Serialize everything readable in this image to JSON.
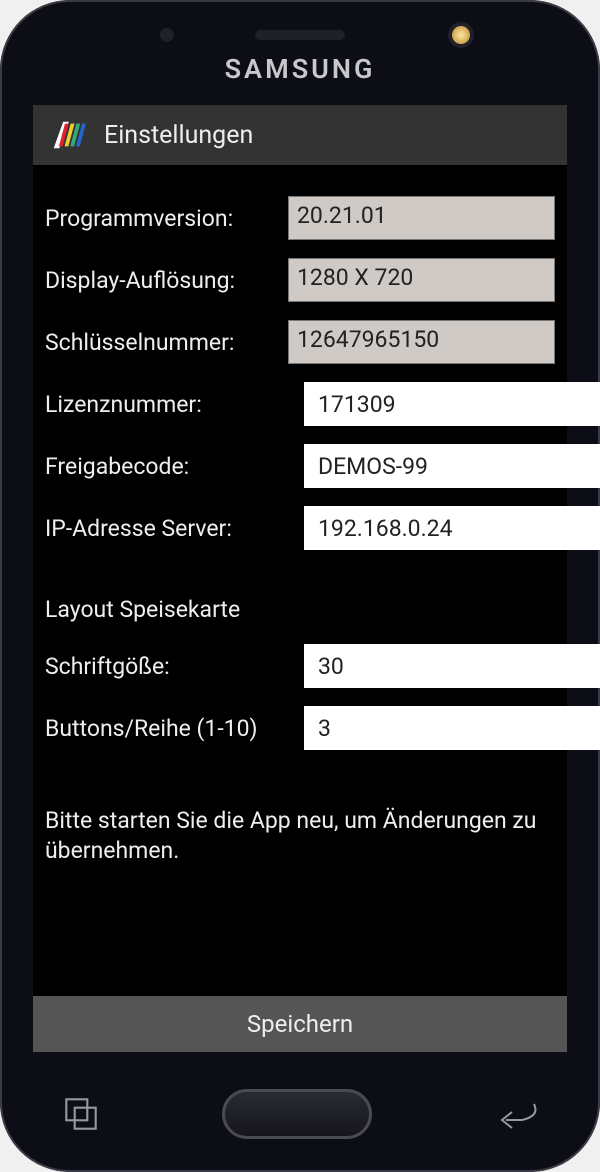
{
  "device": {
    "brand": "SAMSUNG"
  },
  "header": {
    "title": "Einstellungen"
  },
  "fields": {
    "version": {
      "label": "Programmversion:",
      "value": "20.21.01"
    },
    "display": {
      "label": "Display-Auflösung:",
      "value": "1280 X 720"
    },
    "key": {
      "label": "Schlüsselnummer:",
      "value": "12647965150"
    },
    "license": {
      "label": "Lizenznummer:",
      "value": "171309"
    },
    "release": {
      "label": "Freigabecode:",
      "value": "DEMOS-99"
    },
    "ip": {
      "label": "IP-Adresse Server:",
      "value": "192.168.0.24"
    }
  },
  "layout": {
    "section": "Layout Speisekarte",
    "font": {
      "label": "Schriftgöße:",
      "value": "30"
    },
    "buttons": {
      "label": "Buttons/Reihe (1-10)",
      "value": "3"
    }
  },
  "hint": "Bitte starten Sie die App neu, um Änderungen zu übernehmen.",
  "actions": {
    "save": "Speichern"
  }
}
